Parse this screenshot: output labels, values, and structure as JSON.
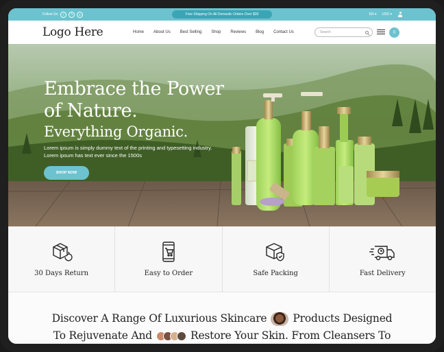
{
  "topbar": {
    "follow_label": "Follow Us:",
    "social": [
      {
        "icon": "facebook-icon",
        "glyph": "f"
      },
      {
        "icon": "x-icon",
        "glyph": "𝕏"
      },
      {
        "icon": "linkedin-icon",
        "glyph": "in"
      }
    ],
    "promo": "Free Shipping On All Domestic Orders Over $30",
    "language": "EN ▾",
    "currency": "USD ▾"
  },
  "header": {
    "logo": "Logo Here",
    "nav": [
      "Home",
      "About Us",
      "Best Selling",
      "Shop",
      "Reviews",
      "Blog",
      "Contact Us"
    ],
    "search_placeholder": "Search",
    "cart_count": "0"
  },
  "hero": {
    "line1": "Embrace the Power",
    "line2": "of Nature.",
    "line3": "Everything Organic.",
    "description": "Lorem ipsum is simply dummy text of the printing and typesetting industry. Lorem ipsum has text ever since the 1500s",
    "button": "SHOP NOW"
  },
  "features": [
    {
      "label": "30 Days Return",
      "icon": "return-box-icon"
    },
    {
      "label": "Easy to Order",
      "icon": "mobile-cart-icon"
    },
    {
      "label": "Safe Packing",
      "icon": "shield-box-icon"
    },
    {
      "label": "Fast Delivery",
      "icon": "delivery-truck-icon"
    }
  ],
  "intro": {
    "line1_a": "Discover A Range Of Luxurious Skincare",
    "line1_b": "Products Designed",
    "line2_a": "To Rejuvenate And",
    "line2_b": "Restore Your Skin. From Cleansers To"
  },
  "colors": {
    "accent": "#6cc3cf",
    "accent_dark": "#3aa6b5",
    "text": "#222222"
  }
}
